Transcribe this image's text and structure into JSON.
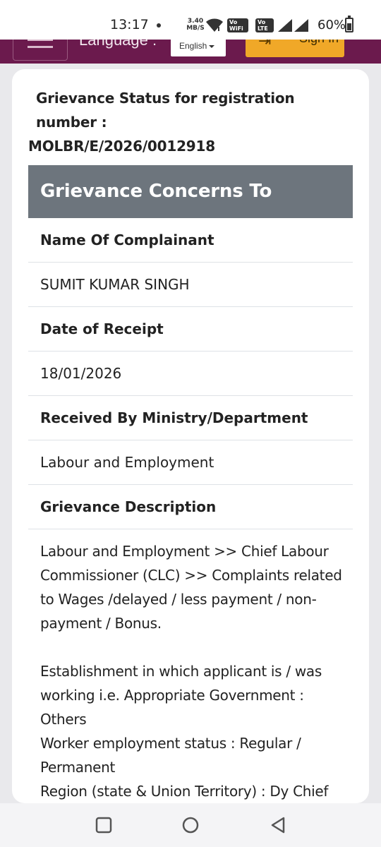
{
  "status_bar": {
    "time": "13:17",
    "net_speed_value": "3.40",
    "net_speed_unit": "MB/S",
    "vowifi_label_top": "Vo",
    "vowifi_label_bottom": "WiFi 2",
    "volte_label_top": "Vo",
    "volte_label_bottom": "LTE 1",
    "battery_percent": "60%",
    "battery_level": 0.6
  },
  "header": {
    "language_label": "Language :",
    "language_selected": "English",
    "signin_label": "Sign In",
    "brand_color": "#6b1a4d",
    "signin_color": "#f0a828"
  },
  "card": {
    "status_title_line1": "Grievance Status for registration number :",
    "status_title_line2": "MOLBR/E/2026/0012918",
    "section_header": "Grievance Concerns To",
    "section_header_color": "#6d757d",
    "fields": [
      {
        "label": "Name Of Complainant",
        "value": "SUMIT KUMAR SINGH"
      },
      {
        "label": "Date of Receipt",
        "value": "18/01/2026"
      },
      {
        "label": "Received By Ministry/Department",
        "value": "Labour and Employment"
      },
      {
        "label": "Grievance Description"
      }
    ],
    "description": {
      "para1": "Labour and Employment >> Chief Labour Commissioner (CLC) >> Complaints related to Wages /delayed / less payment / non-payment / Bonus.",
      "line1": "Establishment in which applicant is / was working i.e. Appropriate Government : Others",
      "line2": "Worker employment status : Regular / Permanent",
      "line3": "Region (state & Union Territory) : Dy Chief Labour Commissioner (Bhunabeswar)"
    }
  },
  "nav_bar": {
    "recent_icon": "square-recent-apps-icon",
    "home_icon": "circle-home-icon",
    "back_icon": "triangle-back-icon"
  }
}
